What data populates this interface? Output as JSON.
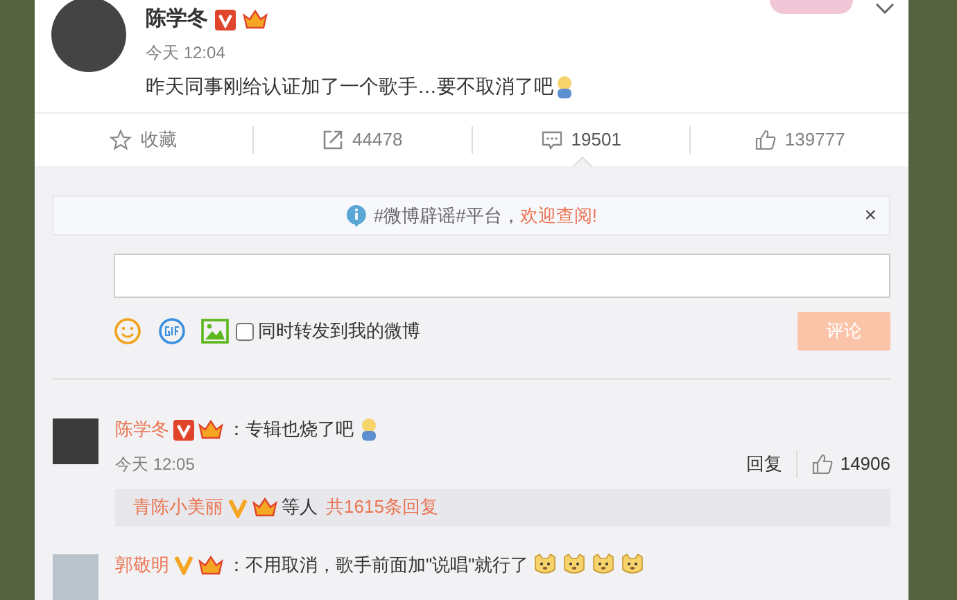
{
  "post": {
    "author": "陈学冬",
    "time": "今天 12:04",
    "text": "昨天同事刚给认证加了一个歌手…要不取消了吧"
  },
  "actions": [
    {
      "kind": "star",
      "label": "收藏",
      "selected": false
    },
    {
      "kind": "repost",
      "label": "44478",
      "selected": false
    },
    {
      "kind": "comment",
      "label": "19501",
      "selected": true
    },
    {
      "kind": "like",
      "label": "139777",
      "selected": false
    }
  ],
  "notice": {
    "text": "#微博辟谣#平台，",
    "link": "欢迎查阅!",
    "close": "×"
  },
  "composer": {
    "also_repost": {
      "label": "同时转发到我的微博",
      "checked": false
    },
    "submit": {
      "label": "评论",
      "disabled": true
    }
  },
  "comments": [
    {
      "author": "陈学冬",
      "text": "：专辑也烧了吧",
      "emojis": [
        {
          "kind": "pray"
        }
      ],
      "time": "今天 12:05",
      "reply": "回复",
      "likes": "14906",
      "thread": {
        "author": "青陈小美丽",
        "middle": "等人",
        "count": "共1615条回复"
      }
    },
    {
      "author": "郭敬明",
      "text": "：不用取消，歌手前面加\"说唱\"就行了",
      "emojis": [
        {
          "kind": "doge"
        },
        {
          "kind": "doge"
        },
        {
          "kind": "doge"
        },
        {
          "kind": "doge"
        }
      ]
    }
  ]
}
